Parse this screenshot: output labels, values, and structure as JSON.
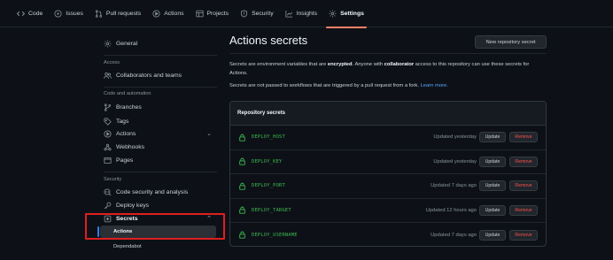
{
  "topnav": {
    "tabs": [
      {
        "label": "Code",
        "icon": "code-icon"
      },
      {
        "label": "Issues",
        "icon": "issue-icon"
      },
      {
        "label": "Pull requests",
        "icon": "pull-request-icon"
      },
      {
        "label": "Actions",
        "icon": "play-icon"
      },
      {
        "label": "Projects",
        "icon": "table-icon"
      },
      {
        "label": "Security",
        "icon": "shield-icon"
      },
      {
        "label": "Insights",
        "icon": "graph-icon"
      },
      {
        "label": "Settings",
        "icon": "gear-icon",
        "active": true
      }
    ]
  },
  "sidebar": {
    "general": "General",
    "access_heading": "Access",
    "collaborators": "Collaborators and teams",
    "code_heading": "Code and automation",
    "branches": "Branches",
    "tags": "Tags",
    "actions": "Actions",
    "webhooks": "Webhooks",
    "pages": "Pages",
    "security_heading": "Security",
    "code_security": "Code security and analysis",
    "deploy_keys": "Deploy keys",
    "secrets": "Secrets",
    "secrets_sub": [
      "Actions",
      "Dependabot"
    ]
  },
  "main": {
    "title": "Actions secrets",
    "new_button": "New repository secret",
    "desc1_a": "Secrets are environment variables that are ",
    "desc1_b": "encrypted",
    "desc1_c": ". Anyone with ",
    "desc1_d": "collaborator",
    "desc1_e": " access to this repository can use these secrets for Actions.",
    "desc2": "Secrets are not passed to workflows that are triggered by a pull request from a fork.",
    "learn_more": "Learn more.",
    "panel_title": "Repository secrets",
    "update_label": "Update",
    "remove_label": "Remove",
    "secrets": [
      {
        "name": "DEPLOY_HOST",
        "updated": "Updated yesterday"
      },
      {
        "name": "DEPLOY_KEY",
        "updated": "Updated yesterday"
      },
      {
        "name": "DEPLOY_PORT",
        "updated": "Updated 7 days ago"
      },
      {
        "name": "DEPLOY_TARGET",
        "updated": "Updated 12 hours ago"
      },
      {
        "name": "DEPLOY_USERNAME",
        "updated": "Updated 7 days ago"
      }
    ]
  },
  "colors": {
    "accent_tab": "#f78166",
    "secret_name": "#3fb950",
    "remove": "#f85149",
    "link": "#58a6ff",
    "highlight_box": "#e01e1e"
  }
}
